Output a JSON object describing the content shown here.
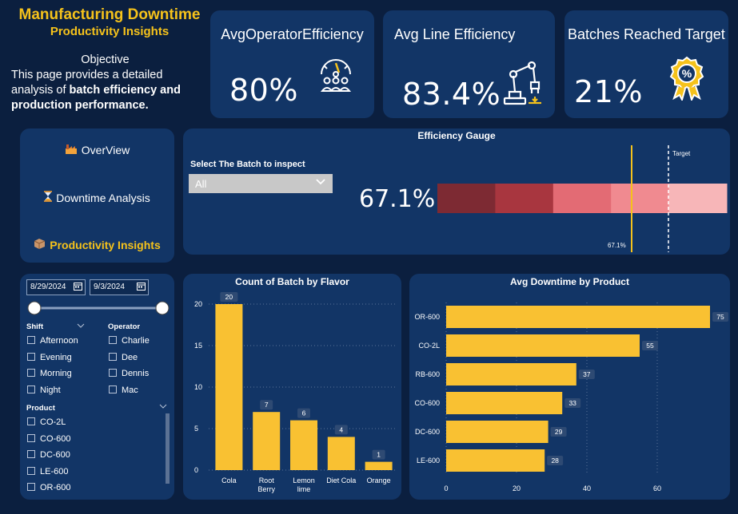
{
  "header": {
    "title": "Manufacturing Downtime",
    "subtitle": "Productivity Insights",
    "objective_title": "Objective",
    "objective_line1": "This page provides a detailed",
    "objective_line2_plain": "analysis of ",
    "objective_line2_bold": "batch efficiency and",
    "objective_line3_bold": "production performance."
  },
  "kpis": {
    "operator": {
      "label": "AvgOperatorEfficiency",
      "value": "80%",
      "icon": "gauge-people-icon"
    },
    "line": {
      "label": "Avg Line Efficiency",
      "value": "83.4%",
      "icon": "robot-arm-icon"
    },
    "batches": {
      "label": "Batches Reached Target",
      "value": "21%",
      "icon": "percent-badge-icon"
    }
  },
  "nav": {
    "overview": "OverView",
    "downtime": "Downtime Analysis",
    "productivity": "Productivity Insights"
  },
  "gauge": {
    "title": "Efficiency Gauge",
    "select_label": "Select The Batch to inspect",
    "select_value": "All",
    "value": "67.1%",
    "marker_label": "67.1%",
    "target_label": "Target",
    "colors": [
      "#7d2a33",
      "#a8363f",
      "#e36b74",
      "#f08a90",
      "#f7b6b8"
    ]
  },
  "filters": {
    "date_start": "8/29/2024",
    "date_end": "9/3/2024",
    "shift_header": "Shift",
    "operator_header": "Operator",
    "product_header": "Product",
    "shifts": [
      "Afternoon",
      "Evening",
      "Morning",
      "Night"
    ],
    "operators": [
      "Charlie",
      "Dee",
      "Dennis",
      "Mac"
    ],
    "products": [
      "CO-2L",
      "CO-600",
      "DC-600",
      "LE-600",
      "OR-600"
    ]
  },
  "chart_data": [
    {
      "type": "bar",
      "title": "Count of Batch by Flavor",
      "categories": [
        "Cola",
        "Root Berry",
        "Lemon lime",
        "Diet Cola",
        "Orange"
      ],
      "values": [
        20,
        7,
        6,
        4,
        1
      ],
      "ylim": [
        0,
        20
      ],
      "yticks": [
        0,
        5,
        10,
        15,
        20
      ],
      "color": "#f9c132"
    },
    {
      "type": "bar",
      "orientation": "horizontal",
      "title": "Avg Downtime by Product",
      "categories": [
        "OR-600",
        "CO-2L",
        "RB-600",
        "CO-600",
        "DC-600",
        "LE-600"
      ],
      "values": [
        75,
        55,
        37,
        33,
        29,
        28
      ],
      "xlim": [
        0,
        75
      ],
      "xticks": [
        0,
        20,
        40,
        60
      ],
      "color": "#f9c132"
    }
  ],
  "colors": {
    "background": "#0b1f3f",
    "card": "#123566",
    "accent": "#f5c21b",
    "bar": "#f9c132"
  }
}
